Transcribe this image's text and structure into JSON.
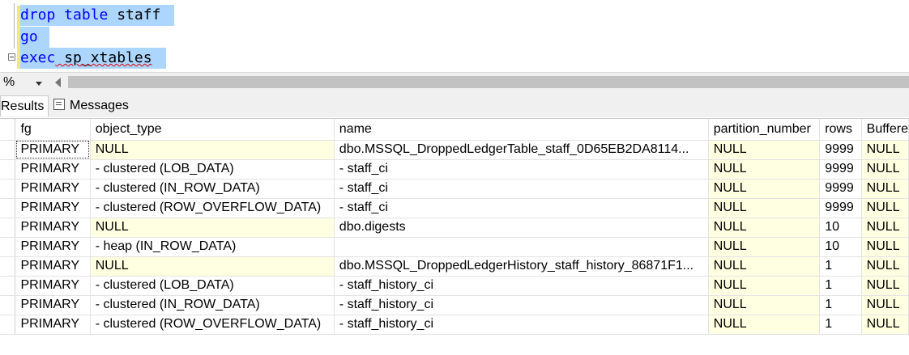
{
  "editor": {
    "lines": [
      {
        "keyword": "drop table",
        "rest": " staff"
      },
      {
        "keyword": "go",
        "rest": ""
      },
      {
        "keyword": "exec",
        "rest": " sp_xtables"
      }
    ]
  },
  "zoom": {
    "value": "%"
  },
  "tabs": {
    "results": "Results",
    "messages": "Messages"
  },
  "grid": {
    "columns": [
      "fg",
      "object_type",
      "name",
      "partition_number",
      "rows",
      "Buffere"
    ],
    "rows": [
      [
        "PRIMARY",
        "NULL",
        "dbo.MSSQL_DroppedLedgerTable_staff_0D65EB2DA8114...",
        "NULL",
        "9999",
        "NULL"
      ],
      [
        "PRIMARY",
        " - clustered (LOB_DATA)",
        " - staff_ci",
        "NULL",
        "9999",
        "NULL"
      ],
      [
        "PRIMARY",
        " - clustered (IN_ROW_DATA)",
        " - staff_ci",
        "NULL",
        "9999",
        "NULL"
      ],
      [
        "PRIMARY",
        " - clustered (ROW_OVERFLOW_DATA)",
        " - staff_ci",
        "NULL",
        "9999",
        "NULL"
      ],
      [
        "PRIMARY",
        "NULL",
        "dbo.digests",
        "NULL",
        "10",
        "NULL"
      ],
      [
        "PRIMARY",
        " - heap (IN_ROW_DATA)",
        "",
        "NULL",
        "10",
        "NULL"
      ],
      [
        "PRIMARY",
        "NULL",
        "dbo.MSSQL_DroppedLedgerHistory_staff_history_86871F1...",
        "NULL",
        "1",
        "NULL"
      ],
      [
        "PRIMARY",
        " - clustered (LOB_DATA)",
        " - staff_history_ci",
        "NULL",
        "1",
        "NULL"
      ],
      [
        "PRIMARY",
        " - clustered (IN_ROW_DATA)",
        " - staff_history_ci",
        "NULL",
        "1",
        "NULL"
      ],
      [
        "PRIMARY",
        " - clustered (ROW_OVERFLOW_DATA)",
        " - staff_history_ci",
        "NULL",
        "1",
        "NULL"
      ]
    ]
  },
  "colors": {
    "selection": "#add6ff",
    "keyword": "#0000ff",
    "null_cell": "#ffffe1",
    "change_bar": "#f5e67a"
  }
}
